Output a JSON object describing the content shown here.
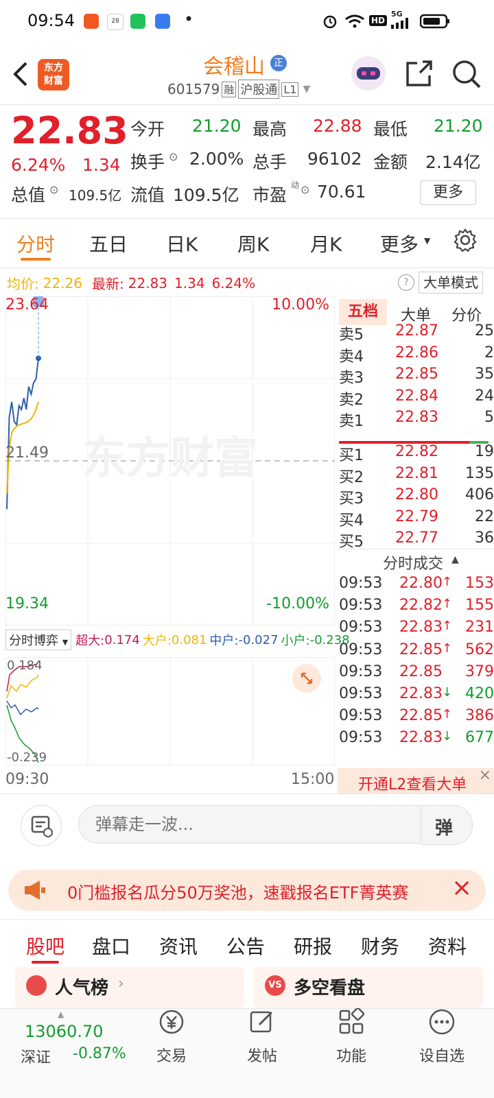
{
  "status_bar": {
    "time": "09:54",
    "dot": "•",
    "hd": "HD",
    "signal": "5G"
  },
  "header": {
    "logo_text": "东方\n财富",
    "stock_name": "会稽山",
    "name_badge": "正",
    "stock_code": "601579",
    "tags": [
      "融",
      "沪股通",
      "L1"
    ]
  },
  "quote": {
    "price": "22.83",
    "change_pct": "6.24%",
    "change_amt": "1.34",
    "open_label": "今开",
    "open": "21.20",
    "high_label": "最高",
    "high": "22.88",
    "low_label": "最低",
    "low": "21.20",
    "turnover_label": "换手",
    "turnover": "2.00%",
    "volume_label": "总手",
    "volume": "96102",
    "amount_label": "金额",
    "amount": "2.14亿",
    "mktcap_label": "总值",
    "mktcap": "109.5亿",
    "float_label": "流值",
    "float": "109.5亿",
    "pe_label": "市盈",
    "pe_sup": "动",
    "pe": "70.61",
    "more_button": "更多"
  },
  "ktabs": [
    "分时",
    "五日",
    "日K",
    "周K",
    "月K",
    "更多"
  ],
  "info_line": {
    "avg_label": "均价:",
    "avg": "22.26",
    "latest_label": "最新:",
    "latest": "22.83",
    "chg": "1.34",
    "pct": "6.24%",
    "mode_button": "大单模式"
  },
  "chart_data": {
    "type": "line",
    "title": "",
    "y_top": "23.64",
    "y_mid": "21.49",
    "y_bottom": "19.34",
    "pct_top": "10.00%",
    "pct_bottom": "-10.00%",
    "ylim": [
      19.34,
      23.64
    ],
    "xlim_label": [
      "09:30",
      "15:00"
    ],
    "watermark": "东方财富",
    "series": [
      {
        "color": "#2c5ea8",
        "values": [
          20.86,
          22.06,
          22.26,
          22.01,
          21.96,
          22.21,
          22.16,
          22.31,
          22.16,
          22.46,
          22.36,
          22.51,
          22.56,
          22.83
        ]
      },
      {
        "color": "#f0b400",
        "values": [
          21.06,
          21.66,
          21.86,
          21.91,
          21.94,
          21.96,
          21.97,
          21.98,
          21.99,
          22.01,
          22.04,
          22.09,
          22.16,
          22.26
        ]
      }
    ]
  },
  "flow": {
    "selector": "分时博弈",
    "super_label": "超大:",
    "super": "0.174",
    "large_label": "大户:",
    "large": "0.081",
    "mid_label": "中户:",
    "mid": "-0.027",
    "small_label": "小户:",
    "small": "-0.238",
    "y_top": "0.184",
    "y_bottom": "-0.239",
    "time_start": "09:30",
    "time_end": "15:00"
  },
  "orderbook": {
    "tabs": [
      "五档",
      "大单",
      "分价"
    ],
    "asks": [
      {
        "label": "卖5",
        "price": "22.87",
        "vol": "25"
      },
      {
        "label": "卖4",
        "price": "22.86",
        "vol": "2"
      },
      {
        "label": "卖3",
        "price": "22.85",
        "vol": "35"
      },
      {
        "label": "卖2",
        "price": "22.84",
        "vol": "24"
      },
      {
        "label": "卖1",
        "price": "22.83",
        "vol": "5"
      }
    ],
    "bids": [
      {
        "label": "买1",
        "price": "22.82",
        "vol": "19"
      },
      {
        "label": "买2",
        "price": "22.81",
        "vol": "135"
      },
      {
        "label": "买3",
        "price": "22.80",
        "vol": "406"
      },
      {
        "label": "买4",
        "price": "22.79",
        "vol": "22"
      },
      {
        "label": "买5",
        "price": "22.77",
        "vol": "36"
      }
    ],
    "trades_title": "分时成交",
    "trades": [
      {
        "time": "09:53",
        "price": "22.80",
        "dir": "↑",
        "vol": "153",
        "up": true
      },
      {
        "time": "09:53",
        "price": "22.82",
        "dir": "↑",
        "vol": "155",
        "up": true
      },
      {
        "time": "09:53",
        "price": "22.83",
        "dir": "↑",
        "vol": "231",
        "up": true
      },
      {
        "time": "09:53",
        "price": "22.85",
        "dir": "↑",
        "vol": "562",
        "up": true
      },
      {
        "time": "09:53",
        "price": "22.85",
        "dir": "",
        "vol": "379",
        "up": true
      },
      {
        "time": "09:53",
        "price": "22.83",
        "dir": "↓",
        "vol": "420",
        "up": false
      },
      {
        "time": "09:53",
        "price": "22.85",
        "dir": "↑",
        "vol": "386",
        "up": true
      },
      {
        "time": "09:53",
        "price": "22.83",
        "dir": "↓",
        "vol": "677",
        "up": false
      }
    ],
    "l2_banner": "开通L2查看大单"
  },
  "comment": {
    "placeholder": "弹幕走一波..."
  },
  "promo": {
    "text": "0门槛报名瓜分50万奖池，速戳报名ETF菁英赛"
  },
  "section_tabs": [
    "股吧",
    "盘口",
    "资讯",
    "公告",
    "研报",
    "财务",
    "资料"
  ],
  "cards": [
    {
      "title": "人气榜"
    },
    {
      "title": "多空看盘"
    }
  ],
  "bottom": {
    "index_value": "13060.70",
    "index_name": "深证",
    "index_change": "-0.87%",
    "items": [
      "交易",
      "发帖",
      "功能",
      "设自选"
    ]
  }
}
